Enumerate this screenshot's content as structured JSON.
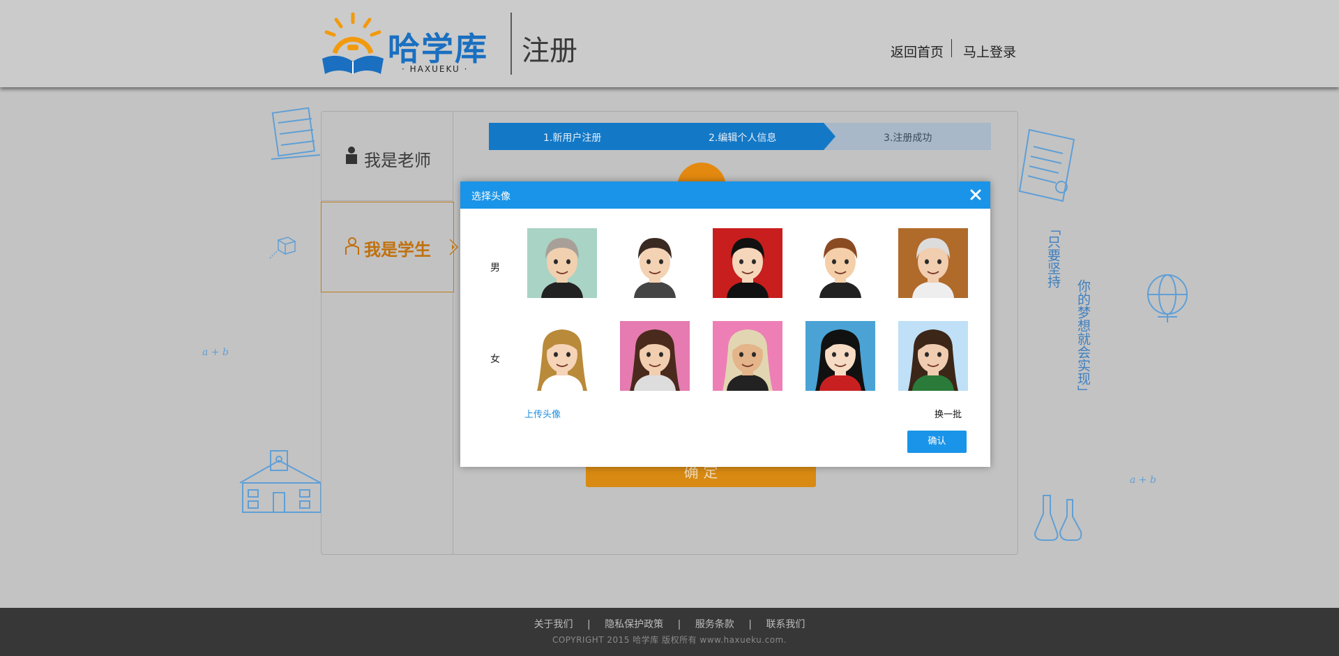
{
  "header": {
    "logo_text": "哈学库",
    "logo_sub": "· HAXUEKU ·",
    "page_title": "注册",
    "nav_home": "返回首页",
    "nav_login": "马上登录"
  },
  "sidebar": {
    "teacher": "我是老师",
    "student": "我是学生"
  },
  "steps": [
    "1.新用户注册",
    "2.编辑个人信息",
    "3.注册成功"
  ],
  "confirm_label": "确 定",
  "decor": {
    "quote_left": "「只要坚持",
    "quote_right": "你的梦想就会实现」",
    "formula": "a + b"
  },
  "dialog": {
    "title": "选择头像",
    "male_label": "男",
    "female_label": "女",
    "upload_label": "上传头像",
    "swap_label": "换一批",
    "ok_label": "确认"
  },
  "avatars": {
    "male": [
      {
        "bg": "#a9d3c4",
        "skin": "#f1d0b0",
        "hair": "#a8a098",
        "shirt": "#222"
      },
      {
        "bg": "#ffffff",
        "skin": "#f4d2b4",
        "hair": "#3a2a22",
        "shirt": "#444"
      },
      {
        "bg": "#c81e1e",
        "skin": "#f6d6ba",
        "hair": "#111",
        "shirt": "#111"
      },
      {
        "bg": "#ffffff",
        "skin": "#f4cfa9",
        "hair": "#8a4a22",
        "shirt": "#222"
      },
      {
        "bg": "#b06a2a",
        "skin": "#f1ceb0",
        "hair": "#dcdcdc",
        "shirt": "#eee"
      }
    ],
    "female": [
      {
        "bg": "#ffffff",
        "skin": "#f6d4b8",
        "hair": "#b98a3a",
        "shirt": "#fff"
      },
      {
        "bg": "#e57bb0",
        "skin": "#f2ceb0",
        "hair": "#4a2a1c",
        "shirt": "#ddd"
      },
      {
        "bg": "#ee7fb6",
        "skin": "#e4b48a",
        "hair": "#e2d6b2",
        "shirt": "#222"
      },
      {
        "bg": "#4aa3d4",
        "skin": "#f6dcc4",
        "hair": "#111",
        "shirt": "#c82020"
      },
      {
        "bg": "#bfe0f6",
        "skin": "#f0cdb0",
        "hair": "#3c2618",
        "shirt": "#2a7a3a"
      }
    ]
  },
  "footer": {
    "links": [
      "关于我们",
      "隐私保护政策",
      "服务条款",
      "联系我们"
    ],
    "separator": "|",
    "copyright": "COPYRIGHT 2015  哈学库  版权所有    www.haxueku.com."
  },
  "colors": {
    "brand_blue": "#1a94e8",
    "brand_orange": "#e4890f",
    "step_done": "#1379c7",
    "step_todo": "#a8b8c8"
  }
}
